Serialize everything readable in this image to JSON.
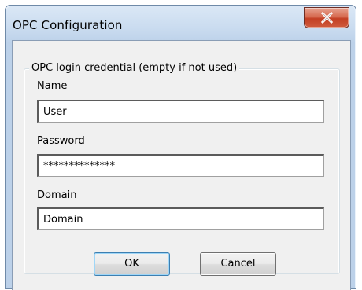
{
  "window": {
    "title": "OPC Configuration"
  },
  "titlebar": {
    "close_icon": "close-icon"
  },
  "groupbox": {
    "legend": "OPC login credential (empty if not used)"
  },
  "fields": {
    "name": {
      "label": "Name",
      "value": "User"
    },
    "password": {
      "label": "Password",
      "value": "**************"
    },
    "domain": {
      "label": "Domain",
      "value": "Domain"
    }
  },
  "buttons": {
    "ok_label": "OK",
    "cancel_label": "Cancel"
  },
  "colors": {
    "close_button": "#c84a2e",
    "window_frame": "#bcd1e9",
    "client_bg": "#f0f0f0"
  }
}
